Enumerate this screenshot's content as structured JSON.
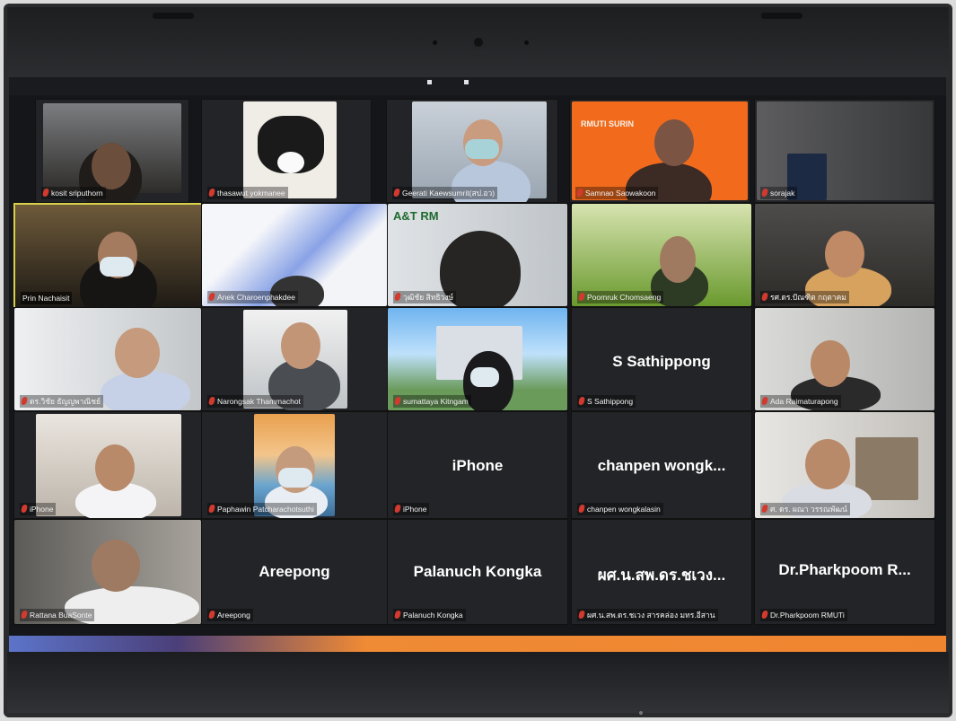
{
  "participants": [
    {
      "name": "kosit sriputhorn",
      "muted": true
    },
    {
      "name": "thasawut yokmanee",
      "muted": true
    },
    {
      "name": "Geerati Kaewsumrit(สป.อว)",
      "muted": true
    },
    {
      "name": "Samnao Saowakoon",
      "muted": true
    },
    {
      "name": "sorajak",
      "muted": true
    },
    {
      "name": "Prin Nachaisit",
      "muted": false
    },
    {
      "name": "Anek Charoenphakdee",
      "muted": true
    },
    {
      "name": "วุฒิชัย สิทธิวงษ์",
      "muted": true
    },
    {
      "name": "Poomruk Chomsaeng",
      "muted": true
    },
    {
      "name": "รศ.ดร.ปัณฑิต กฤตาคม",
      "muted": true
    },
    {
      "name": "ดร.วิชัย ธัญญพาณิชย์",
      "muted": true
    },
    {
      "name": "Narongsak Thammachot",
      "muted": true
    },
    {
      "name": "sumattaya Kitngam",
      "muted": true
    },
    {
      "name": "S Sathippong",
      "muted": true
    },
    {
      "name": "Ada Raimaturapong",
      "muted": true
    },
    {
      "name": "iPhone",
      "muted": true
    },
    {
      "name": "Paphawin Patcharachotsuthi",
      "muted": true
    },
    {
      "name": "iPhone",
      "muted": true
    },
    {
      "name": "chanpen wongkalasin",
      "muted": true
    },
    {
      "name": "ศ. ดร. ผณา วรรณพัฒน์",
      "muted": true
    },
    {
      "name": "Rattana BuaSonte",
      "muted": true
    },
    {
      "name": "Areepong",
      "muted": true
    },
    {
      "name": "Palanuch Kongka",
      "muted": true
    },
    {
      "name": "ผศ.น.สพ.ดร.ชเวง สารคล่อง มทร.อีสาน",
      "muted": true
    },
    {
      "name": "Dr.Pharkpoom RMUTi",
      "muted": true
    }
  ],
  "big_names": {
    "sathippong": "S Sathippong",
    "iphone": "iPhone",
    "chanpen": "chanpen  wongk...",
    "areepong": "Areepong",
    "palanuch": "Palanuch Kongka",
    "chaweng": "ผศ.น.สพ.ดร.ชเวง...",
    "pharkpoom": "Dr.Pharkpoom  R..."
  },
  "logos": {
    "rmuti_surin": "RMUTI SURIN",
    "at": "A&T RM"
  },
  "colors": {
    "screen_bg": "#151619",
    "tile_bg": "#232427",
    "active_border": "#d8d04a",
    "mute_red": "#d33a2f"
  }
}
